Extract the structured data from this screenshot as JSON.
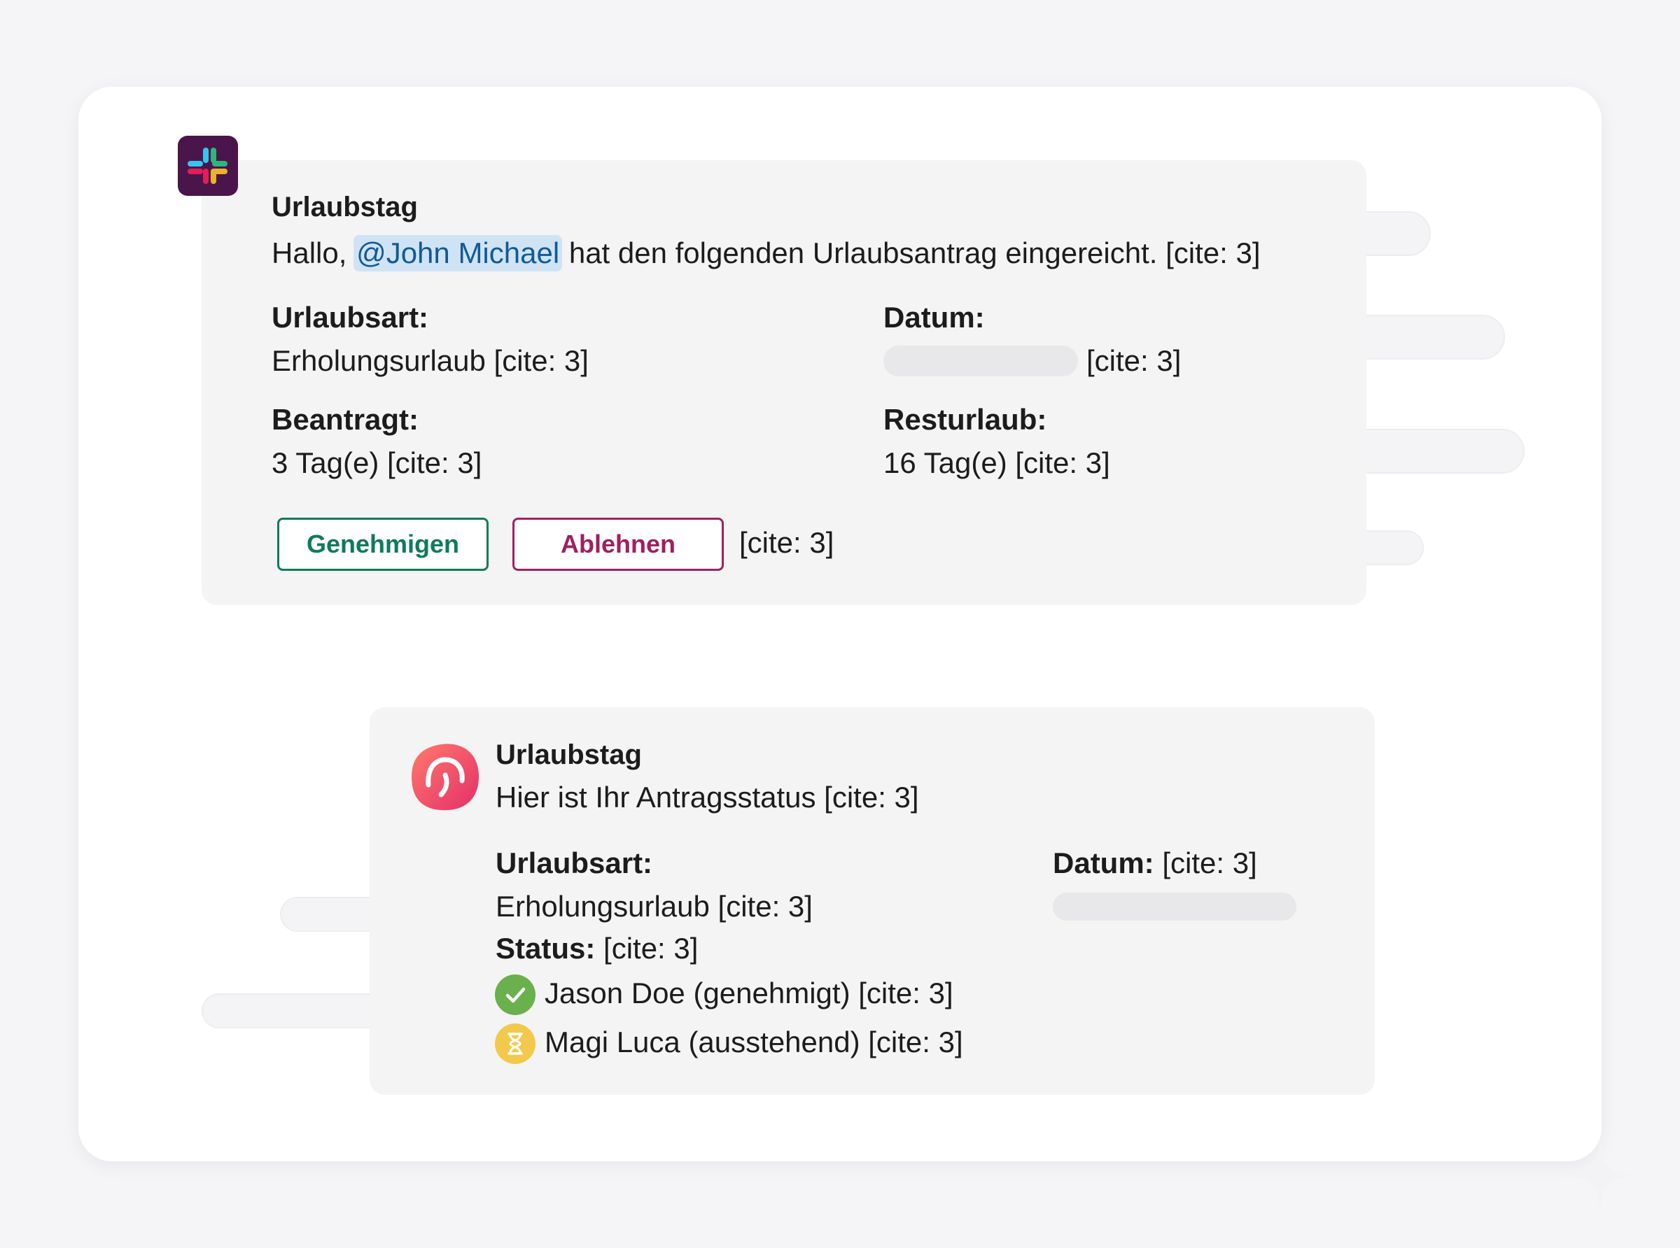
{
  "request_card": {
    "app_name": "Urlaubstag",
    "greeting": "Hallo,",
    "mention": "@John Michael",
    "message": "hat den folgenden Urlaubsantrag eingereicht. [cite: 3]",
    "fields": {
      "leave_type_label": "Urlaubsart:",
      "leave_type_value": "Erholungsurlaub [cite: 3]",
      "date_label": "Datum:",
      "date_value": "[cite: 3]",
      "requested_label": "Beantragt:",
      "requested_value": "3 Tag(e) [cite: 3]",
      "remaining_label": "Resturlaub:",
      "remaining_value": "16 Tag(e) [cite: 3]"
    },
    "approve_label": "Genehmigen",
    "reject_label": "Ablehnen",
    "buttons_cite": "[cite: 3]"
  },
  "status_card": {
    "app_name": "Urlaubstag",
    "subtitle": "Hier ist Ihr Antragsstatus [cite: 3]",
    "leave_type_label": "Urlaubsart:",
    "leave_type_value": "Erholungsurlaub [cite: 3]",
    "status_label": "Status:",
    "status_value": "[cite: 3]",
    "date_label": "Datum:",
    "date_value": "[cite: 3]",
    "approvers": [
      {
        "text": "Jason Doe (genehmigt) [cite: 3]",
        "status": "approved",
        "icon": "check-icon",
        "color": "#6ab04c"
      },
      {
        "text": "Magi Luca (ausstehend) [cite: 3]",
        "status": "pending",
        "icon": "hourglass-icon",
        "color": "#f2c94c"
      }
    ]
  },
  "colors": {
    "approve": "#0f7b5b",
    "reject": "#a0205f",
    "mention_bg": "#cfe3f5",
    "mention_text": "#125a94",
    "slack_bg": "#4a154b",
    "app_icon_gradient": [
      "#ff6b6b",
      "#e8336d"
    ]
  }
}
